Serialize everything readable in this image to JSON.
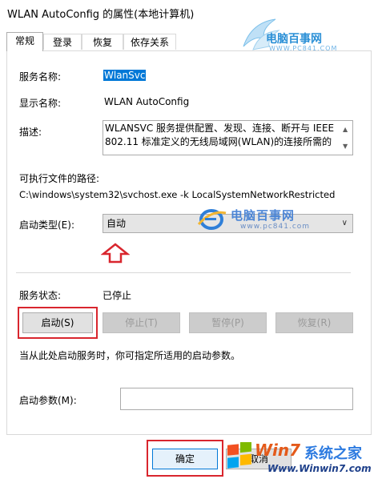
{
  "window": {
    "title": "WLAN AutoConfig 的属性(本地计算机)"
  },
  "tabs": [
    {
      "label": "常规",
      "active": true
    },
    {
      "label": "登录",
      "active": false
    },
    {
      "label": "恢复",
      "active": false
    },
    {
      "label": "依存关系",
      "active": false
    }
  ],
  "general": {
    "service_name_label": "服务名称:",
    "service_name_value": "WlanSvc",
    "display_name_label": "显示名称:",
    "display_name_value": "WLAN AutoConfig",
    "description_label": "描述:",
    "description_value": "WLANSVC 服务提供配置、发现、连接、断开与 IEEE 802.11 标准定义的无线局域网(WLAN)的连接所需的",
    "exe_path_label": "可执行文件的路径:",
    "exe_path_value": "C:\\windows\\system32\\svchost.exe -k LocalSystemNetworkRestricted",
    "startup_type_label": "启动类型(E):",
    "startup_type_value": "自动",
    "service_status_label": "服务状态:",
    "service_status_value": "已停止",
    "hint_text": "当从此处启动服务时，你可指定所适用的启动参数。",
    "start_params_label": "启动参数(M):",
    "start_params_value": ""
  },
  "service_buttons": {
    "start": "启动(S)",
    "stop": "停止(T)",
    "pause": "暂停(P)",
    "resume": "恢复(R)"
  },
  "dialog_buttons": {
    "ok": "确定",
    "cancel": "取消"
  },
  "watermarks": {
    "top_text": "电脑百事网",
    "top_url": "WWW.PC841.COM",
    "mid_text": "电脑百事网",
    "mid_url": "www.pc841.com",
    "bottom_brand_a": "Win7",
    "bottom_brand_b": "系统之家",
    "bottom_url": "Www.Winwin7.com"
  },
  "colors": {
    "highlight": "#d9262e",
    "selection": "#0078d7"
  }
}
